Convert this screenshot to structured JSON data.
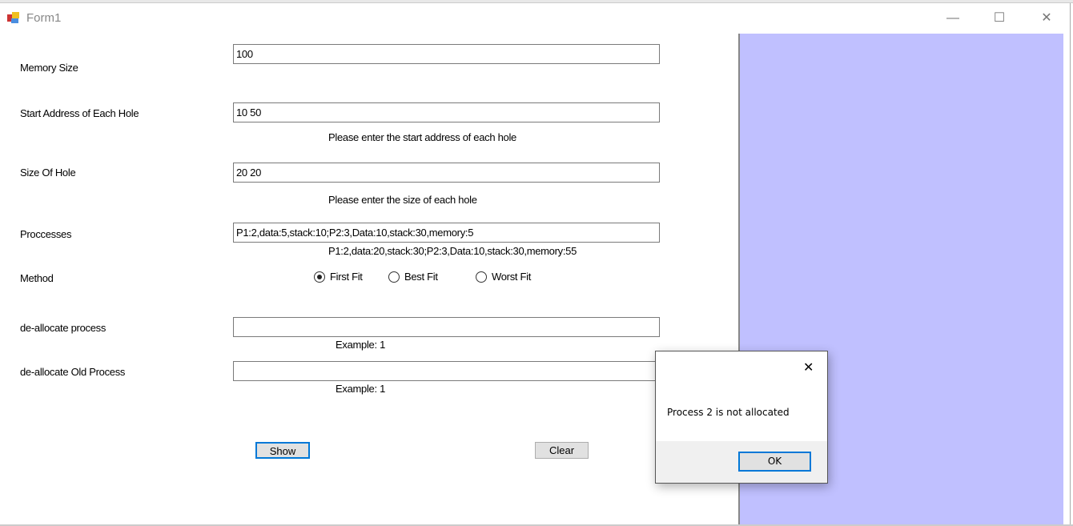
{
  "window": {
    "title": "Form1",
    "icon": "form-app-icon",
    "controls": {
      "minimize": "—",
      "maximize": "☐",
      "close": "✕"
    }
  },
  "form": {
    "memory_size": {
      "label": "Memory Size",
      "value": "100"
    },
    "start_address": {
      "label": "Start Address of Each Hole",
      "value": "10 50",
      "hint": "Please enter the start address of each hole"
    },
    "hole_size": {
      "label": "Size Of Hole",
      "value": "20 20",
      "hint": "Please enter the size of each hole"
    },
    "processes": {
      "label": "Proccesses",
      "value": "P1:2,data:5,stack:10;P2:3,Data:10,stack:30,memory:5",
      "hint": "P1:2,data:20,stack:30;P2:3,Data:10,stack:30,memory:55"
    },
    "method": {
      "label": "Method",
      "options": [
        "First Fit",
        "Best Fit",
        "Worst Fit"
      ],
      "selected": "First Fit"
    },
    "deallocate": {
      "label": "de-allocate process",
      "value": "",
      "hint": "Example: 1"
    },
    "deallocate_old": {
      "label": "de-allocate Old Process",
      "value": "",
      "hint": "Example: 1"
    },
    "show_label": "Show",
    "clear_label": "Clear"
  },
  "panel": {
    "color": "#c0c0ff"
  },
  "dialog": {
    "message": "Process 2 is not allocated",
    "ok_label": "OK",
    "close": "✕"
  }
}
